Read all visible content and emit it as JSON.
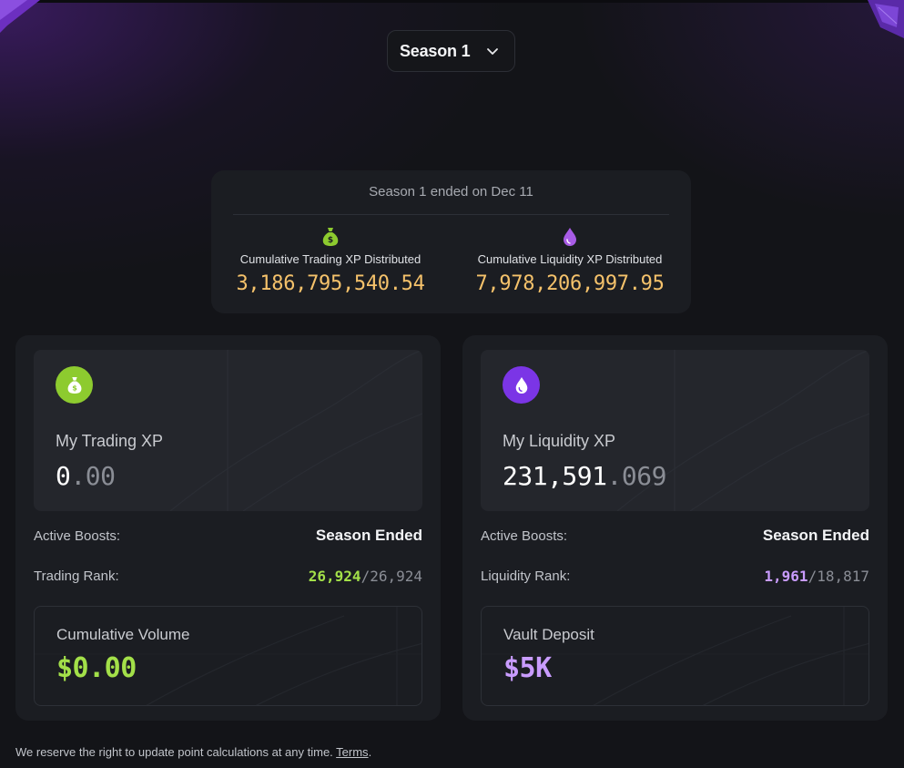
{
  "season_selector": {
    "label": "Season 1",
    "icon": "chevron-down-icon"
  },
  "summary": {
    "ended_text": "Season 1 ended on Dec 11",
    "trading": {
      "icon": "money-bag-icon",
      "caption": "Cumulative Trading XP Distributed",
      "value": "3,186,795,540.54"
    },
    "liquidity": {
      "icon": "droplet-icon",
      "caption": "Cumulative Liquidity XP Distributed",
      "value": "7,978,206,997.95"
    }
  },
  "trading_card": {
    "icon": "money-bag-icon",
    "xp_label": "My Trading XP",
    "xp_whole": "0",
    "xp_fraction": ".00",
    "boosts_label": "Active Boosts:",
    "boosts_value": "Season Ended",
    "rank_label": "Trading Rank:",
    "rank_value": "26,924",
    "rank_total": "/26,924",
    "sub_label": "Cumulative Volume",
    "sub_value": "$0.00"
  },
  "liquidity_card": {
    "icon": "droplet-icon",
    "xp_label": "My Liquidity XP",
    "xp_whole": "231,591",
    "xp_fraction": ".069",
    "boosts_label": "Active Boosts:",
    "boosts_value": "Season Ended",
    "rank_label": "Liquidity Rank:",
    "rank_value": "1,961",
    "rank_total": "/18,817",
    "sub_label": "Vault Deposit",
    "sub_value": "$5K"
  },
  "footer": {
    "text": "We reserve the right to update point calculations at any time. ",
    "link": "Terms",
    "period": "."
  },
  "colors": {
    "trading_accent": "#a3e049",
    "liquidity_accent": "#c99cff",
    "distributed_value": "#f5c26b",
    "background": "#131418"
  }
}
